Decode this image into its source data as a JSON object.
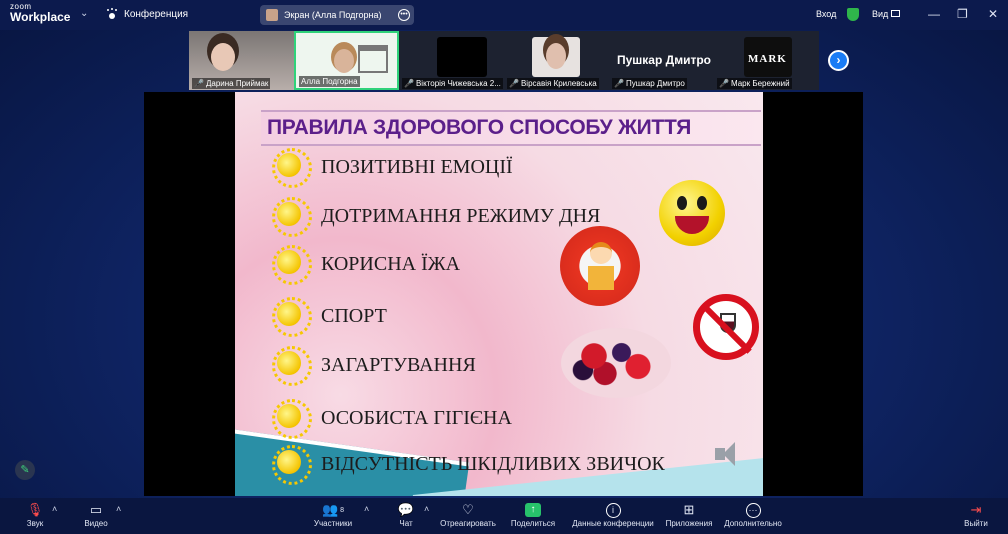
{
  "app": {
    "logo_top": "zoom",
    "logo_bottom": "Workplace",
    "section": "Конференция"
  },
  "screen_pill": {
    "label": "Экран (Алла Подгорна)"
  },
  "window": {
    "login": "Вход",
    "view": "Вид"
  },
  "participants": [
    {
      "name": "Дарина Приймак"
    },
    {
      "name": "Алла Подгорна"
    },
    {
      "name": "Вікторія Чижевська 2..."
    },
    {
      "name": "Вірсавія Крилевська"
    },
    {
      "name": "Пушкар Дмитро",
      "display": "Пушкар Дмитро"
    },
    {
      "name": "Марк Бережний",
      "display": "MARK"
    }
  ],
  "slide": {
    "title": "ПРАВИЛА ЗДОРОВОГО СПОСОБУ ЖИТТЯ",
    "rules": [
      "ПОЗИТИВНІ ЕМОЦІЇ",
      "ДОТРИМАННЯ РЕЖИМУ ДНЯ",
      "КОРИСНА ЇЖА",
      "СПОРТ",
      "ЗАГАРТУВАННЯ",
      "ОСОБИСТА ГІГІЄНА",
      "ВІДСУТНІСТЬ ШКІДЛИВИХ ЗВИЧОК"
    ]
  },
  "toolbar": {
    "audio": "Звук",
    "video": "Видео",
    "participants": "Участники",
    "participants_count": "8",
    "chat": "Чат",
    "react": "Отреагировать",
    "share": "Поделиться",
    "info": "Данные конференции",
    "apps": "Приложения",
    "more": "Дополнительно",
    "leave": "Выйти"
  },
  "colors": {
    "accent": "#1a7cf5",
    "share": "#27c26b",
    "title_text": "#5b1f8a",
    "leave": "#ff4d4d"
  }
}
